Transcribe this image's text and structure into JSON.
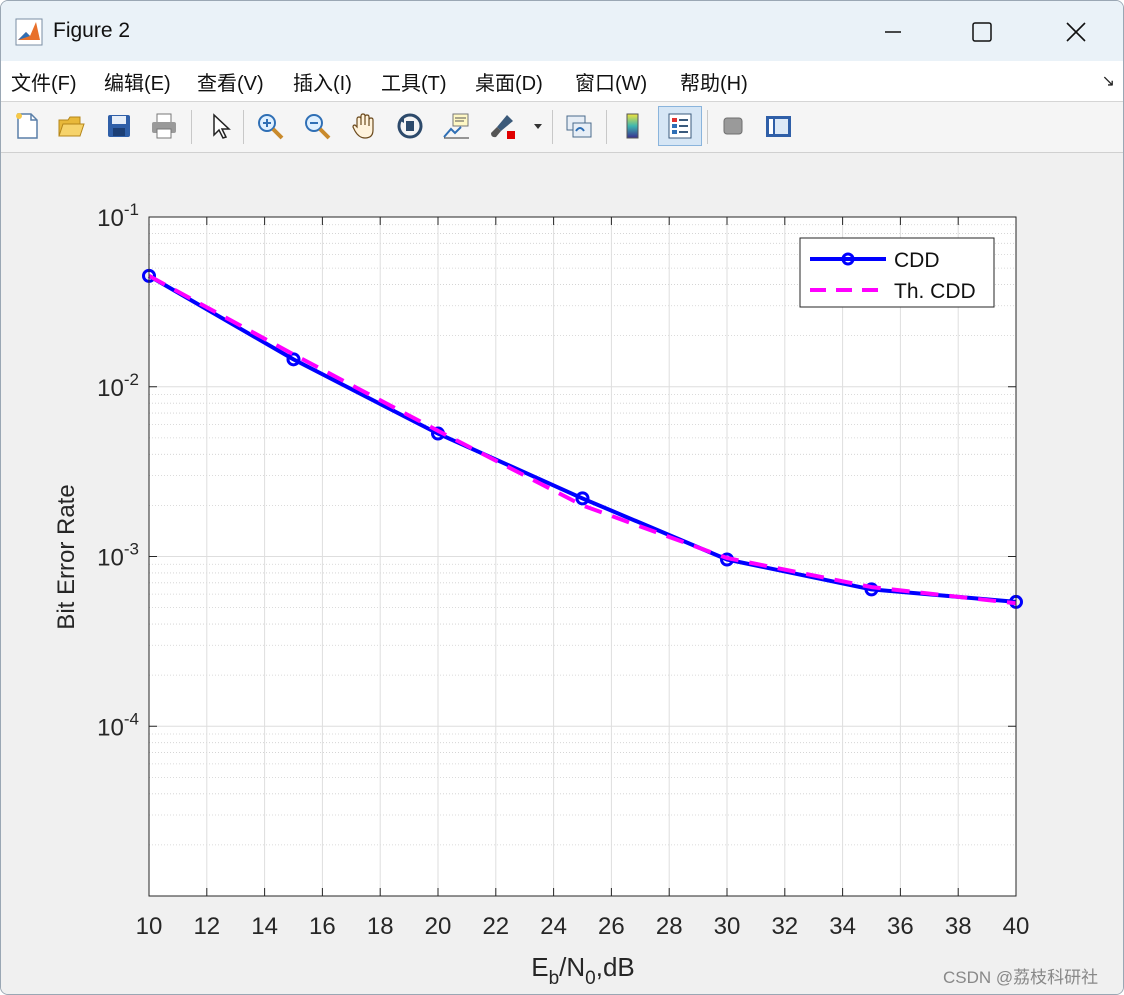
{
  "window": {
    "title": "Figure 2"
  },
  "menu": [
    {
      "label": "文件(F)"
    },
    {
      "label": "编辑(E)"
    },
    {
      "label": "查看(V)"
    },
    {
      "label": "插入(I)"
    },
    {
      "label": "工具(T)"
    },
    {
      "label": "桌面(D)"
    },
    {
      "label": "窗口(W)"
    },
    {
      "label": "帮助(H)"
    }
  ],
  "toolbar": [
    {
      "icon": "new-figure-icon"
    },
    {
      "icon": "open-file-icon"
    },
    {
      "icon": "save-icon"
    },
    {
      "icon": "print-icon"
    },
    {
      "icon": "select-pointer-icon"
    },
    {
      "icon": "zoom-in-icon"
    },
    {
      "icon": "zoom-out-icon"
    },
    {
      "icon": "pan-hand-icon"
    },
    {
      "icon": "rotate-3d-icon"
    },
    {
      "icon": "data-cursor-icon"
    },
    {
      "icon": "brush-icon"
    },
    {
      "icon": "link-plot-icon"
    },
    {
      "icon": "colorbar-icon"
    },
    {
      "icon": "legend-icon"
    },
    {
      "icon": "hide-plot-tools-icon"
    },
    {
      "icon": "show-plot-tools-icon"
    }
  ],
  "watermark": "CSDN @荔枝科研社",
  "chart_data": {
    "type": "line",
    "title": "",
    "xlabel": {
      "base": "E",
      "sub1": "b",
      "mid": "/N",
      "sub2": "0",
      "tail": ",dB"
    },
    "ylabel": "Bit Error Rate",
    "xlim": [
      10,
      40
    ],
    "ylim": [
      1e-05,
      0.1
    ],
    "yscale": "log",
    "grid": true,
    "minor_grid": true,
    "legend_position": "top-right",
    "xticks": [
      10,
      12,
      14,
      16,
      18,
      20,
      22,
      24,
      26,
      28,
      30,
      32,
      34,
      36,
      38,
      40
    ],
    "yticks": [
      {
        "value": 0.1,
        "base": "10",
        "exp": "-1"
      },
      {
        "value": 0.01,
        "base": "10",
        "exp": "-2"
      },
      {
        "value": 0.001,
        "base": "10",
        "exp": "-3"
      },
      {
        "value": 0.0001,
        "base": "10",
        "exp": "-4"
      }
    ],
    "series": [
      {
        "name": "CDD",
        "color": "#0000ff",
        "style": "solid",
        "marker": "circle",
        "x": [
          10,
          15,
          20,
          25,
          30,
          35,
          40
        ],
        "y": [
          0.045,
          0.0145,
          0.0053,
          0.0022,
          0.00096,
          0.00064,
          0.00054
        ]
      },
      {
        "name": "Th. CDD",
        "color": "#ff00ff",
        "style": "dashed",
        "marker": "none",
        "x": [
          10,
          15,
          20,
          25,
          30,
          35,
          40
        ],
        "y": [
          0.045,
          0.0155,
          0.0055,
          0.002,
          0.00098,
          0.00066,
          0.00053
        ]
      }
    ]
  }
}
